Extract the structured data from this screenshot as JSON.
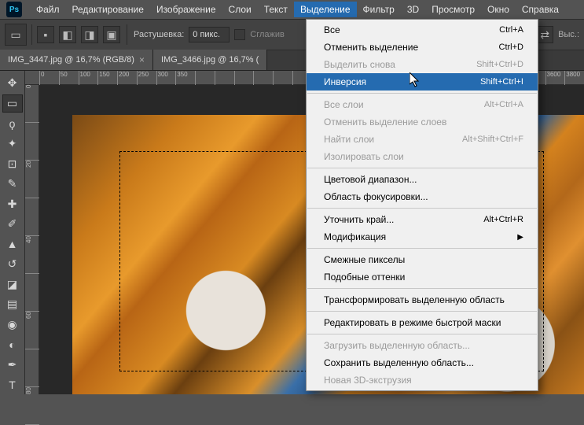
{
  "logo": "Ps",
  "menubar": {
    "items": [
      "Файл",
      "Редактирование",
      "Изображение",
      "Слои",
      "Текст",
      "Выделение",
      "Фильтр",
      "3D",
      "Просмотр",
      "Окно",
      "Справка"
    ],
    "active_index": 5
  },
  "optbar": {
    "feather_label": "Растушевка:",
    "feather_value": "0 пикс.",
    "antialias_label": "Сглажив",
    "wys_label": "Выс.:"
  },
  "tabs": [
    {
      "title": "IMG_3447.jpg @ 16,7% (RGB/8)"
    },
    {
      "title": "IMG_3466.jpg @ 16,7% ("
    }
  ],
  "hruler_ticks": [
    "0",
    "50",
    "100",
    "150",
    "200",
    "250",
    "300",
    "350",
    "",
    "",
    "",
    "",
    "",
    "",
    "",
    "",
    "",
    "",
    "",
    "",
    "",
    "",
    "",
    "",
    "",
    "",
    "3600",
    "3800"
  ],
  "vruler_ticks": [
    "0",
    "",
    "20",
    "",
    "40",
    "",
    "60",
    "",
    "80"
  ],
  "dropdown": {
    "groups": [
      [
        {
          "label": "Все",
          "shortcut": "Ctrl+A",
          "disabled": false
        },
        {
          "label": "Отменить выделение",
          "shortcut": "Ctrl+D",
          "disabled": false
        },
        {
          "label": "Выделить снова",
          "shortcut": "Shift+Ctrl+D",
          "disabled": true
        },
        {
          "label": "Инверсия",
          "shortcut": "Shift+Ctrl+I",
          "disabled": false,
          "hover": true
        }
      ],
      [
        {
          "label": "Все слои",
          "shortcut": "Alt+Ctrl+A",
          "disabled": true
        },
        {
          "label": "Отменить выделение слоев",
          "shortcut": "",
          "disabled": true
        },
        {
          "label": "Найти слои",
          "shortcut": "Alt+Shift+Ctrl+F",
          "disabled": true
        },
        {
          "label": "Изолировать слои",
          "shortcut": "",
          "disabled": true
        }
      ],
      [
        {
          "label": "Цветовой диапазон...",
          "shortcut": "",
          "disabled": false
        },
        {
          "label": "Область фокусировки...",
          "shortcut": "",
          "disabled": false
        }
      ],
      [
        {
          "label": "Уточнить край...",
          "shortcut": "Alt+Ctrl+R",
          "disabled": false
        },
        {
          "label": "Модификация",
          "shortcut": "",
          "disabled": false,
          "submenu": true
        }
      ],
      [
        {
          "label": "Смежные пикселы",
          "shortcut": "",
          "disabled": false
        },
        {
          "label": "Подобные оттенки",
          "shortcut": "",
          "disabled": false
        }
      ],
      [
        {
          "label": "Трансформировать выделенную область",
          "shortcut": "",
          "disabled": false
        }
      ],
      [
        {
          "label": "Редактировать в режиме быстрой маски",
          "shortcut": "",
          "disabled": false
        }
      ],
      [
        {
          "label": "Загрузить выделенную область...",
          "shortcut": "",
          "disabled": true
        },
        {
          "label": "Сохранить выделенную область...",
          "shortcut": "",
          "disabled": false
        },
        {
          "label": "Новая 3D-экструзия",
          "shortcut": "",
          "disabled": true
        }
      ]
    ]
  }
}
